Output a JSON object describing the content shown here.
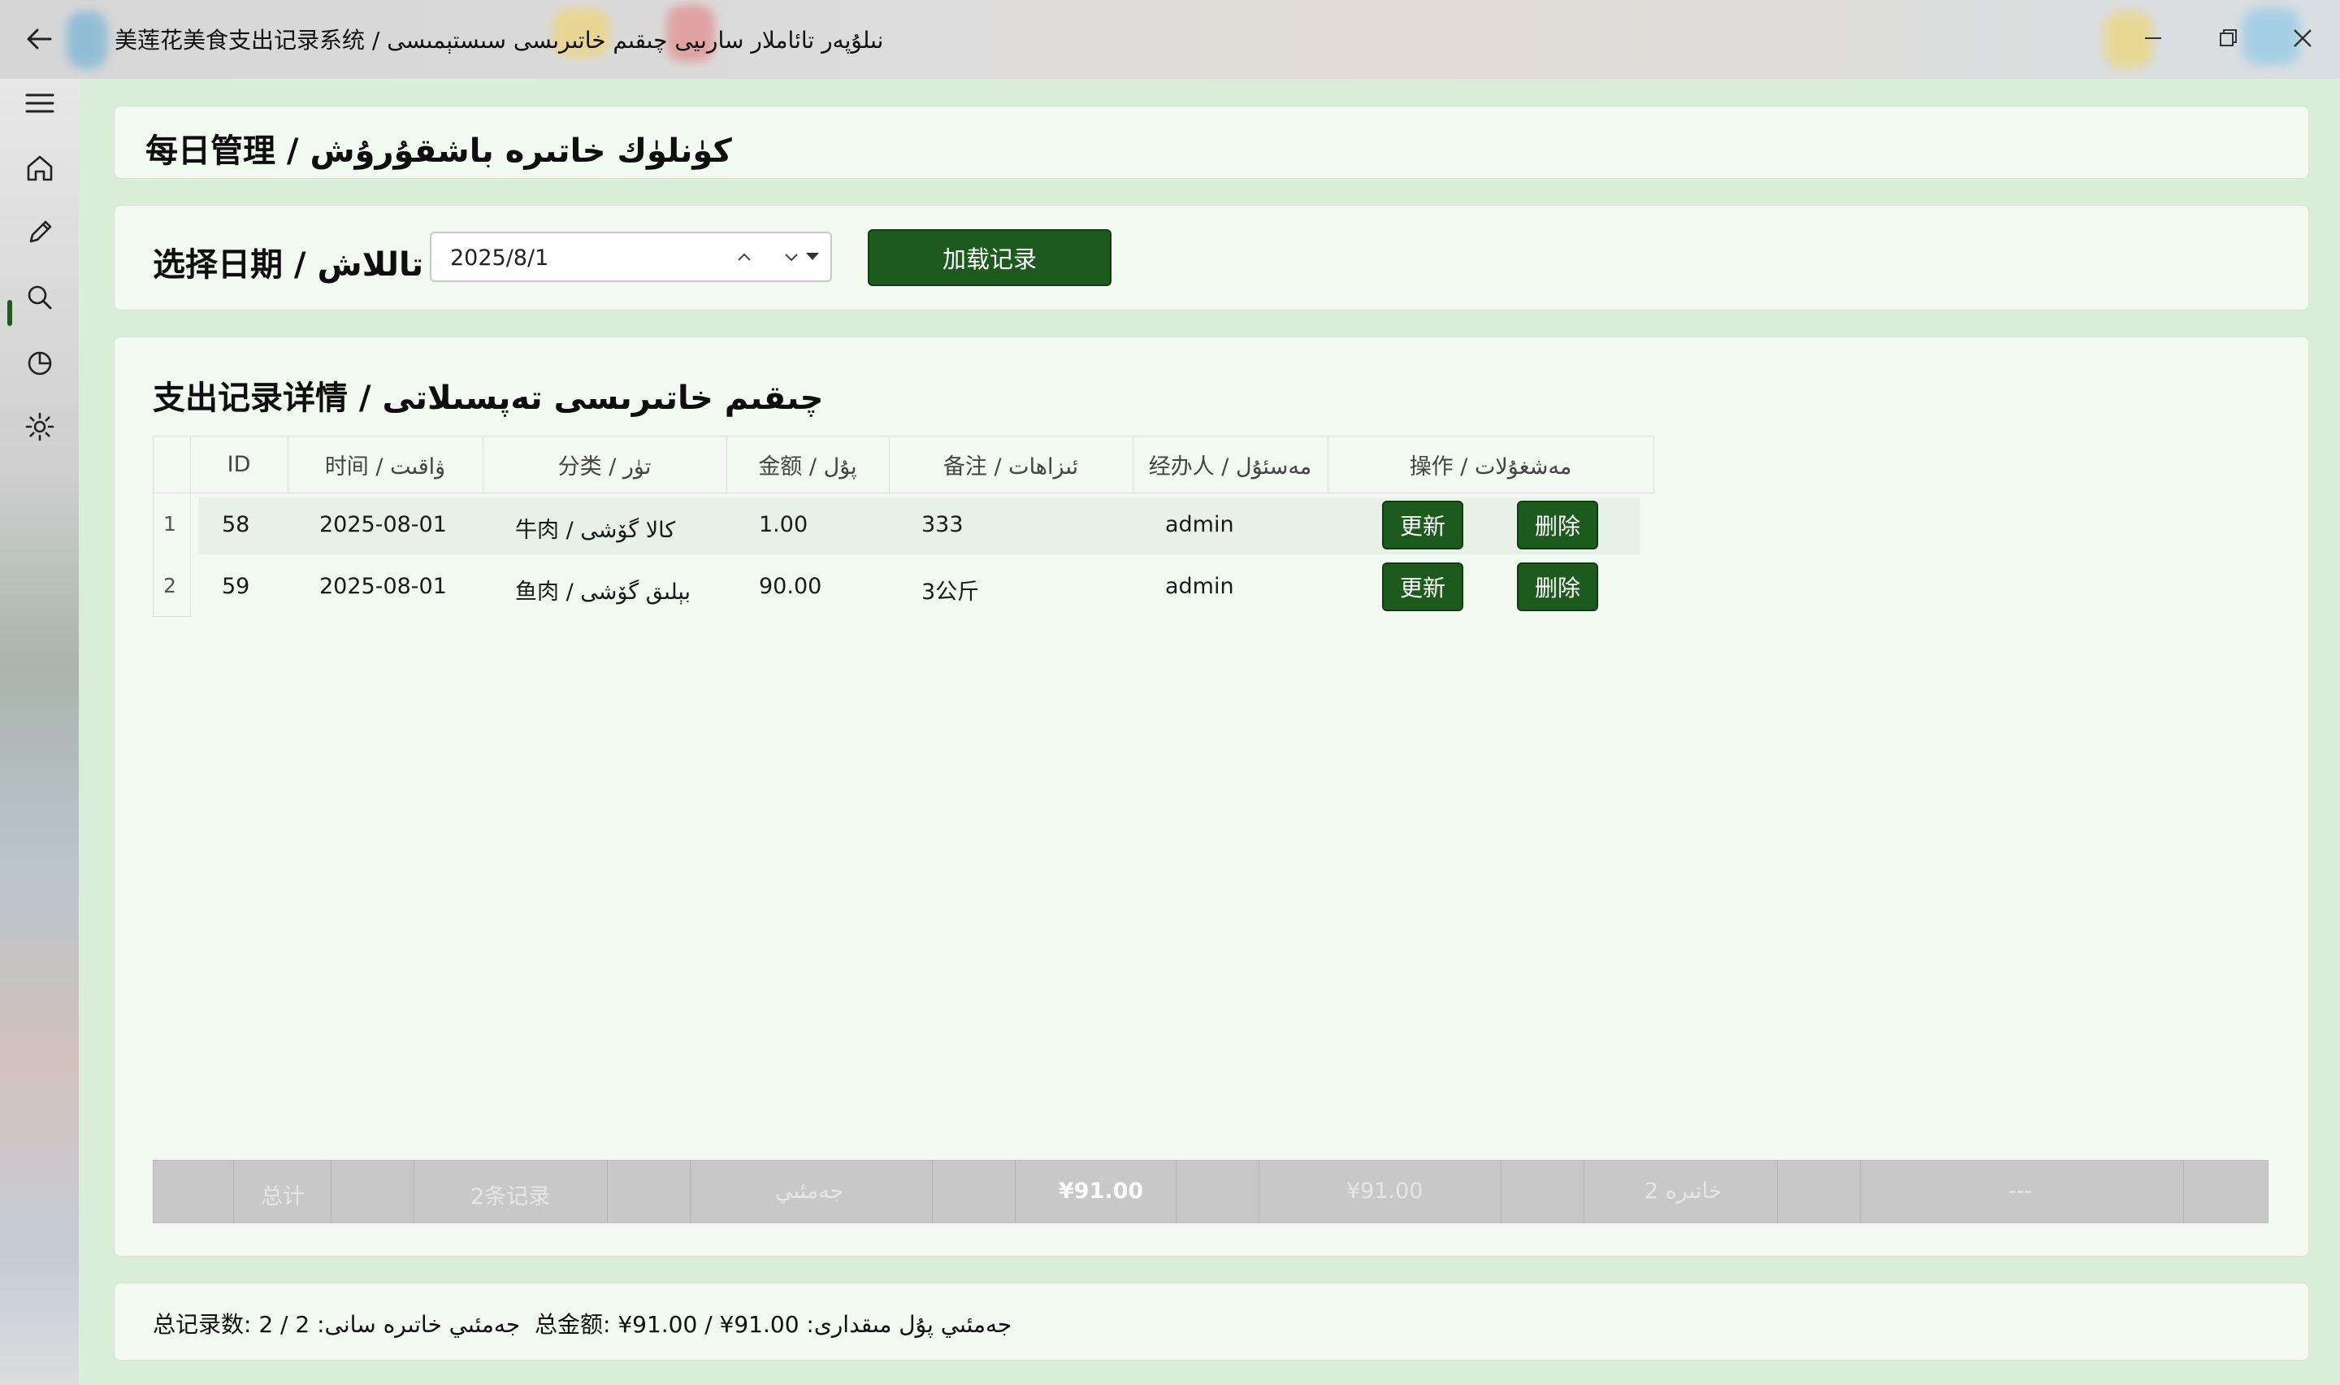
{
  "window": {
    "title": "美莲花美食支出记录系统 / نىلۇپەر تائاملار سارىيى چىقىم خاتىرىسى سىستېمىسى"
  },
  "sidebar": {
    "items": [
      "menu-icon",
      "home-icon",
      "edit-icon",
      "search-icon",
      "chart-icon",
      "settings-icon"
    ],
    "selected": "edit"
  },
  "header": {
    "title": "每日管理 / كۈنلۈك خاتىرە باشقۇرۇش"
  },
  "date_panel": {
    "label": "选择日期 / تاللاش",
    "date_value": "2025/8/1",
    "load_button": "加载记录"
  },
  "details": {
    "title": "支出记录详情 / چىقىم خاتىرىسى تەپسىلاتى",
    "columns": [
      "ID",
      "时间 / ۋاقىت",
      "分类 / تۈر",
      "金额 / پۇل",
      "备注 / ئىزاھات",
      "经办人 / مەسئۇل",
      "操作 / مەشغۇلات"
    ],
    "rows": [
      {
        "num": "1",
        "id": "58",
        "time": "2025-08-01",
        "category": "牛肉 / كالا گۆشى",
        "amount": "1.00",
        "note": "333",
        "operator": "admin",
        "update": "更新",
        "delete": "删除"
      },
      {
        "num": "2",
        "id": "59",
        "time": "2025-08-01",
        "category": "鱼肉 / بېلىق گۆشى",
        "amount": "90.00",
        "note": "3公斤",
        "operator": "admin",
        "update": "更新",
        "delete": "删除"
      }
    ],
    "summary": {
      "total_label": "总计",
      "count_text": "2条记录",
      "sum_label": "جەمئىي",
      "amount_bold": "¥91.00",
      "amount": "¥91.00",
      "count_ug": "2 خاتىرە",
      "dashes": "---"
    }
  },
  "footer": {
    "total_records": "总记录数: 2 / 2 :جەمئىي خاتىرە سانى",
    "total_amount": "总金额: ¥91.00 / ¥91.00 :جەمئىي پۇل مىقدارى"
  },
  "colors": {
    "accent": "#1d5a1d",
    "background": "#d9edd9",
    "card": "#f1f9f1"
  }
}
